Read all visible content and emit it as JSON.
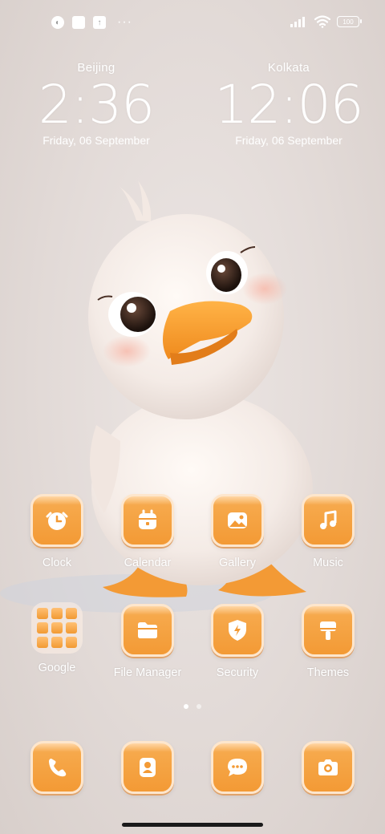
{
  "status_bar": {
    "left_icons": [
      "notification-icon-1",
      "notification-icon-2",
      "notification-icon-3"
    ],
    "more_indicator": "···",
    "battery": "100"
  },
  "clocks": [
    {
      "city": "Beijing",
      "time": "2:36",
      "date": "Friday, 06 September"
    },
    {
      "city": "Kolkata",
      "time": "12:06",
      "date": "Friday, 06 September"
    }
  ],
  "apps": {
    "row1": [
      {
        "label": "Clock",
        "icon": "alarm-clock-icon"
      },
      {
        "label": "Calendar",
        "icon": "calendar-icon"
      },
      {
        "label": "Gallery",
        "icon": "image-icon"
      },
      {
        "label": "Music",
        "icon": "music-note-icon"
      }
    ],
    "row2": [
      {
        "label": "Google",
        "icon": "folder-icon"
      },
      {
        "label": "File Manager",
        "icon": "folder-file-icon"
      },
      {
        "label": "Security",
        "icon": "shield-bolt-icon"
      },
      {
        "label": "Themes",
        "icon": "paint-brush-icon"
      }
    ]
  },
  "dock": [
    {
      "icon": "phone-icon"
    },
    {
      "icon": "contacts-icon"
    },
    {
      "icon": "chat-bubble-icon"
    },
    {
      "icon": "camera-icon"
    }
  ],
  "page_indicator": {
    "total": 2,
    "active": 1
  },
  "colors": {
    "icon_orange": "#f39a35",
    "icon_border": "#fde6cd",
    "bg": "#e5dedb"
  }
}
